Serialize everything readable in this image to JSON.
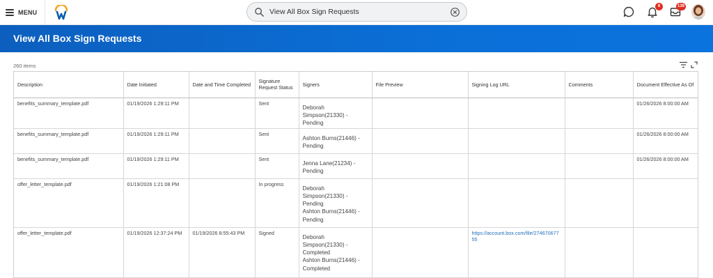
{
  "header": {
    "menu_label": "MENU",
    "search": {
      "value": "View All Box Sign Requests"
    },
    "notifications_count": "6",
    "inbox_count": "139"
  },
  "page": {
    "title": "View All Box Sign Requests",
    "item_count": "260 items"
  },
  "colors": {
    "brand_blue": "#0b6fd7",
    "badge_red": "#de2e21",
    "link_blue": "#1e6fb9",
    "logo_orange": "#f5a623",
    "logo_blue": "#0b5fae"
  },
  "table": {
    "columns": [
      "Description",
      "Date Initiated",
      "Date and Time Completed",
      "Signature Request Status",
      "Signers",
      "File Preview",
      "Signing Log URL",
      "Comments",
      "Document Effective As Of"
    ],
    "rows": [
      {
        "description": "benefits_summary_template.pdf",
        "date_initiated": "01/19/2026 1:29:11 PM",
        "date_completed": "",
        "status": "Sent",
        "signers": [
          "Deborah",
          "Simpson(21330) -",
          "Pending"
        ],
        "file_preview": "",
        "signing_log_url": "",
        "comments": "",
        "effective_as_of": "01/26/2026 8:00:00 AM"
      },
      {
        "description": "benefits_summary_template.pdf",
        "date_initiated": "01/19/2026 1:29:11 PM",
        "date_completed": "",
        "status": "Sent",
        "signers": [
          "Ashton Burns(21446) -",
          "Pending"
        ],
        "file_preview": "",
        "signing_log_url": "",
        "comments": "",
        "effective_as_of": "01/26/2026 8:00:00 AM"
      },
      {
        "description": "benefits_summary_template.pdf",
        "date_initiated": "01/19/2026 1:29:11 PM",
        "date_completed": "",
        "status": "Sent",
        "signers": [
          "Jenna Lane(21234) -",
          "Pending"
        ],
        "file_preview": "",
        "signing_log_url": "",
        "comments": "",
        "effective_as_of": "01/26/2026 8:00:00 AM"
      },
      {
        "description": "offer_letter_template.pdf",
        "date_initiated": "01/19/2026 1:21:08 PM",
        "date_completed": "",
        "status": "In progress",
        "signers": [
          "Deborah",
          "Simpson(21330) -",
          "Pending",
          "Ashton Burns(21446) -",
          "Pending"
        ],
        "file_preview": "",
        "signing_log_url": "",
        "comments": "",
        "effective_as_of": ""
      },
      {
        "description": "offer_letter_template.pdf",
        "date_initiated": "01/19/2026 12:37:24 PM",
        "date_completed": "01/19/2026 8:55:43 PM",
        "status": "Signed",
        "signers": [
          "Deborah",
          "Simpson(21330) -",
          "Completed",
          "Ashton Burns(21446) -",
          "Completed"
        ],
        "file_preview": "",
        "signing_log_url": "https://account.box.com/file/27467067755",
        "comments": "",
        "effective_as_of": ""
      }
    ]
  }
}
